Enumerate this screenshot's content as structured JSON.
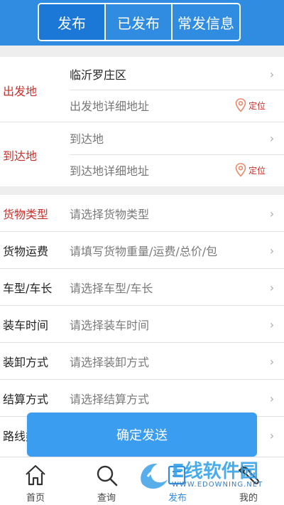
{
  "tabs": {
    "publish": "发布",
    "published": "已发布",
    "frequent": "常发信息"
  },
  "origin": {
    "label": "出发地",
    "value": "临沂罗庄区",
    "detail_placeholder": "出发地详细地址",
    "locate": "定位"
  },
  "destination": {
    "label": "到达地",
    "value_placeholder": "到达地",
    "detail_placeholder": "到达地详细地址",
    "locate": "定位"
  },
  "form": [
    {
      "label": "货物类型",
      "placeholder": "请选择货物类型"
    },
    {
      "label": "货物运费",
      "placeholder": "请填写货物重量/运费/总价/包"
    },
    {
      "label": "车型/车长",
      "placeholder": "请选择车型/车长"
    },
    {
      "label": "装车时间",
      "placeholder": "请选择装车时间"
    },
    {
      "label": "装卸方式",
      "placeholder": "请选择装卸方式"
    },
    {
      "label": "结算方式",
      "placeholder": "请选择结算方式"
    },
    {
      "label": "路线类",
      "placeholder": ""
    }
  ],
  "confirm": "确定发送",
  "nav": {
    "home": "首页",
    "search": "查询",
    "publish": "发布",
    "mine": "我的"
  },
  "watermark": {
    "title": "E线软件园",
    "url": "WWW.EDOWNING.NET"
  },
  "colors": {
    "primary": "#2f8ce0",
    "active_tab": "#1b78d6",
    "label_red": "#c8302b",
    "button": "#3a9df0"
  },
  "icons": {
    "nav": [
      "home-icon",
      "search-icon",
      "publish-icon",
      "wrench-icon"
    ],
    "locate": "location-pin-icon",
    "chevron": "chevron-right-icon"
  }
}
